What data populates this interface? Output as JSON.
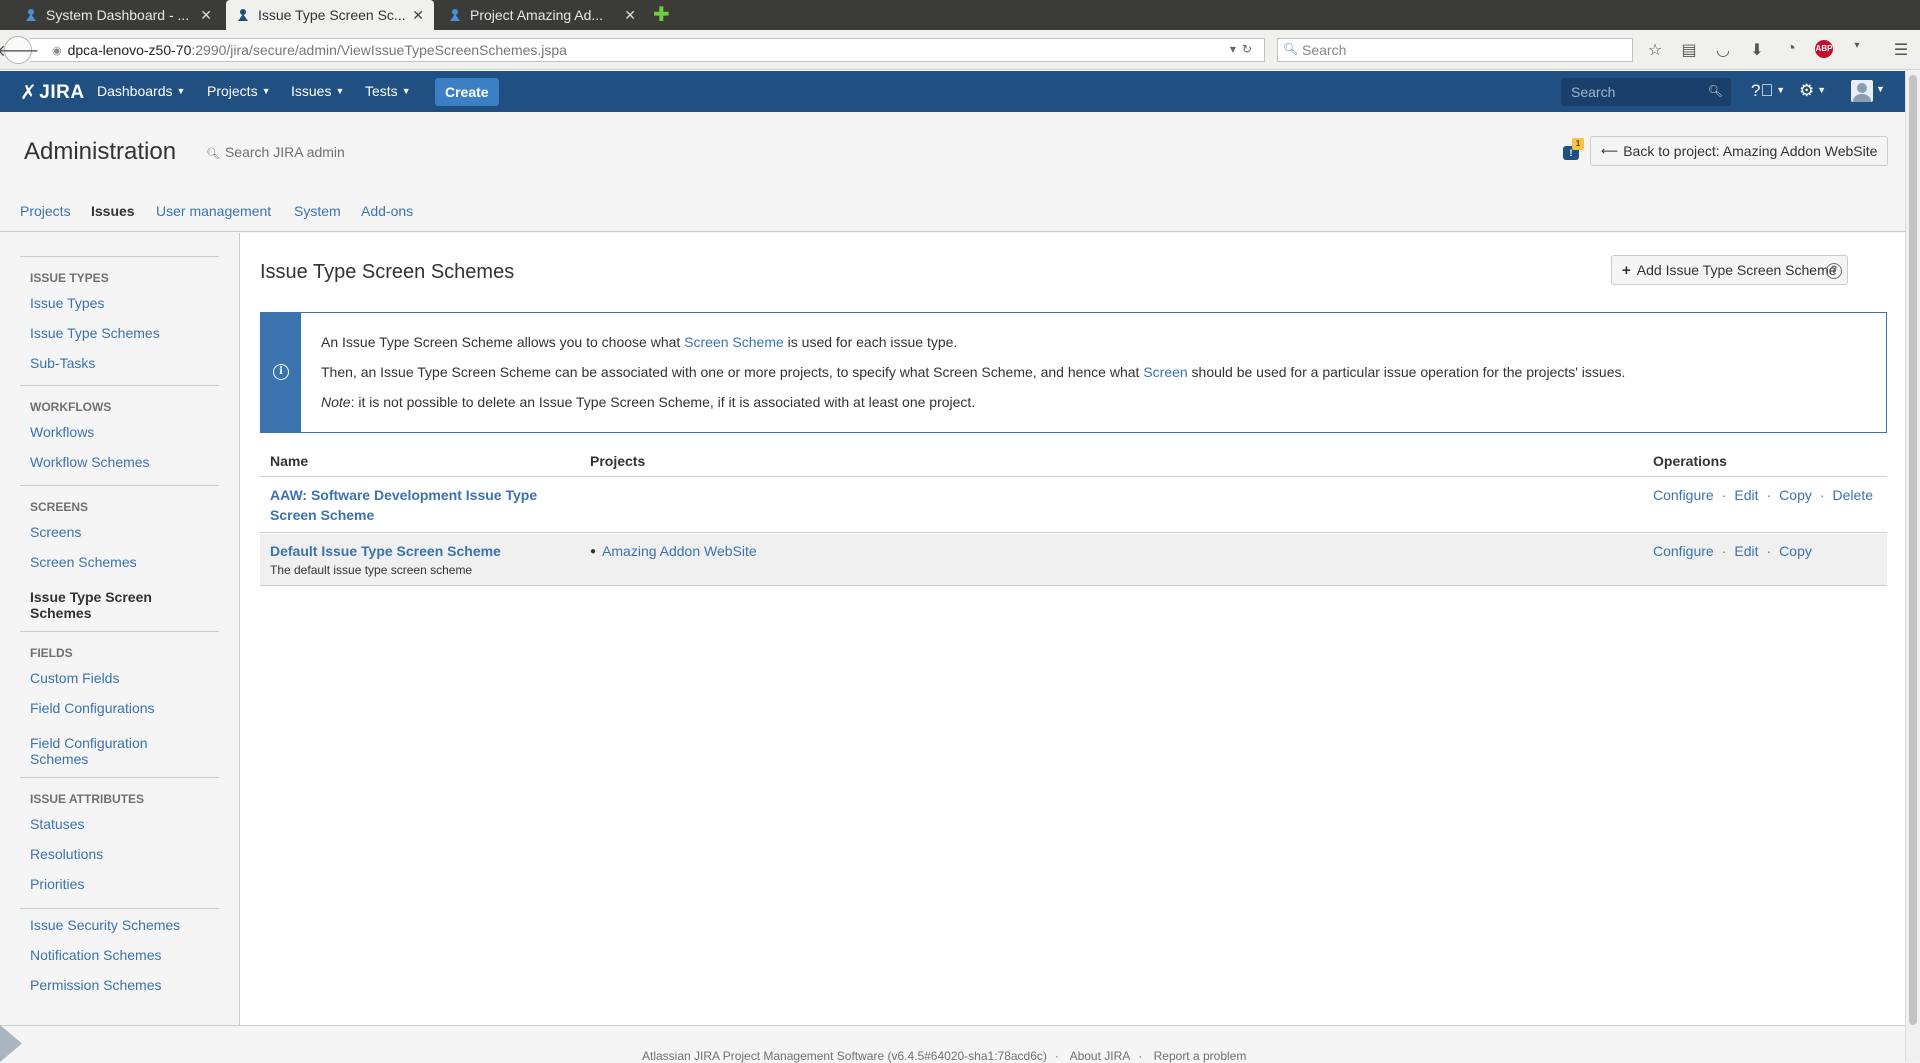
{
  "browser": {
    "tabs": [
      {
        "title": "System Dashboard - ...",
        "active": false
      },
      {
        "title": "Issue Type Screen Sc...",
        "active": true
      },
      {
        "title": "Project Amazing Ad...",
        "active": false
      }
    ],
    "url_host": "dpca-lenovo-z50-70",
    "url_path": ":2990/jira/secure/admin/ViewIssueTypeScreenSchemes.jspa",
    "search_placeholder": "Search"
  },
  "jira_header": {
    "logo": "JIRA",
    "menus": [
      "Dashboards",
      "Projects",
      "Issues",
      "Tests"
    ],
    "create_label": "Create",
    "search_placeholder": "Search"
  },
  "admin": {
    "title": "Administration",
    "search_label": "Search JIRA admin",
    "notification_count": "1",
    "back_label": "Back to project: Amazing Addon WebSite",
    "tabs": [
      "Projects",
      "Issues",
      "User management",
      "System",
      "Add-ons"
    ],
    "active_tab": "Issues"
  },
  "sidebar": {
    "groups": [
      {
        "heading": "Issue Types",
        "items": [
          "Issue Types",
          "Issue Type Schemes",
          "Sub-Tasks"
        ]
      },
      {
        "heading": "Workflows",
        "items": [
          "Workflows",
          "Workflow Schemes"
        ]
      },
      {
        "heading": "Screens",
        "items": [
          "Screens",
          "Screen Schemes",
          "Issue Type Screen Schemes"
        ]
      },
      {
        "heading": "Fields",
        "items": [
          "Custom Fields",
          "Field Configurations",
          "Field Configuration Schemes"
        ]
      },
      {
        "heading": "Issue Attributes",
        "items": [
          "Statuses",
          "Resolutions",
          "Priorities"
        ]
      },
      {
        "heading": "",
        "items": [
          "Issue Security Schemes",
          "Notification Schemes",
          "Permission Schemes"
        ]
      }
    ],
    "selected": "Issue Type Screen Schemes"
  },
  "main": {
    "title": "Issue Type Screen Schemes",
    "add_button": "Add Issue Type Screen Scheme",
    "info": {
      "line1_pre": "An Issue Type Screen Scheme allows you to choose what ",
      "line1_link": "Screen Scheme",
      "line1_post": " is used for each issue type.",
      "line2_pre": "Then, an Issue Type Screen Scheme can be associated with one or more projects, to specify what Screen Scheme, and hence what ",
      "line2_link": "Screen",
      "line2_post": " should be used for a particular issue operation for the projects' issues.",
      "line3_em": "Note",
      "line3_post": ": it is not possible to delete an Issue Type Screen Scheme, if it is associated with at least one project."
    },
    "table": {
      "headers": {
        "name": "Name",
        "projects": "Projects",
        "operations": "Operations"
      },
      "rows": [
        {
          "name_line1": "AAW: Software Development Issue Type",
          "name_line2": "Screen Scheme",
          "description": "",
          "project": "",
          "ops": [
            "Configure",
            "Edit",
            "Copy",
            "Delete"
          ]
        },
        {
          "name_line1": "Default Issue Type Screen Scheme",
          "name_line2": "",
          "description": "The default issue type screen scheme",
          "project": "Amazing Addon WebSite",
          "ops": [
            "Configure",
            "Edit",
            "Copy"
          ]
        }
      ]
    }
  },
  "footer": {
    "software": "Atlassian JIRA Project Management Software (v6.4.5#64020-sha1:78acd6c)",
    "about": "About JIRA",
    "report": "Report a problem"
  }
}
